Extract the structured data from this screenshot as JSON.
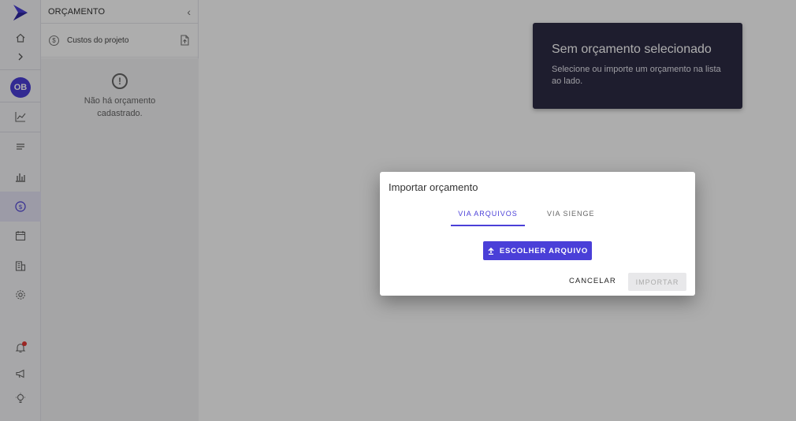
{
  "sidebar": {
    "avatar_initials": "OB",
    "icons": [
      "home-icon",
      "chevron-right-icon",
      "line-chart-icon",
      "list-icon",
      "bar-chart-icon",
      "budget-icon",
      "calendar-icon",
      "building-icon",
      "settings-icon",
      "notification-icon",
      "megaphone-icon",
      "lightbulb-icon"
    ],
    "accent_color": "#4a3fd8",
    "notification_dot_color": "#e53935"
  },
  "panel": {
    "title": "ORÇAMENTO",
    "items": [
      {
        "label": "Custos do projeto",
        "icon": "dollar-icon"
      }
    ],
    "empty_text": "Não há orçamento cadastrado."
  },
  "toast": {
    "title": "Sem orçamento selecionado",
    "body": "Selecione ou importe um orçamento na lista ao lado."
  },
  "dialog": {
    "title": "Importar orçamento",
    "tabs": [
      {
        "label": "VIA ARQUIVOS",
        "active": true
      },
      {
        "label": "VIA SIENGE",
        "active": false
      }
    ],
    "choose_file_label": "ESCOLHER ARQUIVO",
    "cancel_label": "CANCELAR",
    "import_label": "IMPORTAR"
  }
}
